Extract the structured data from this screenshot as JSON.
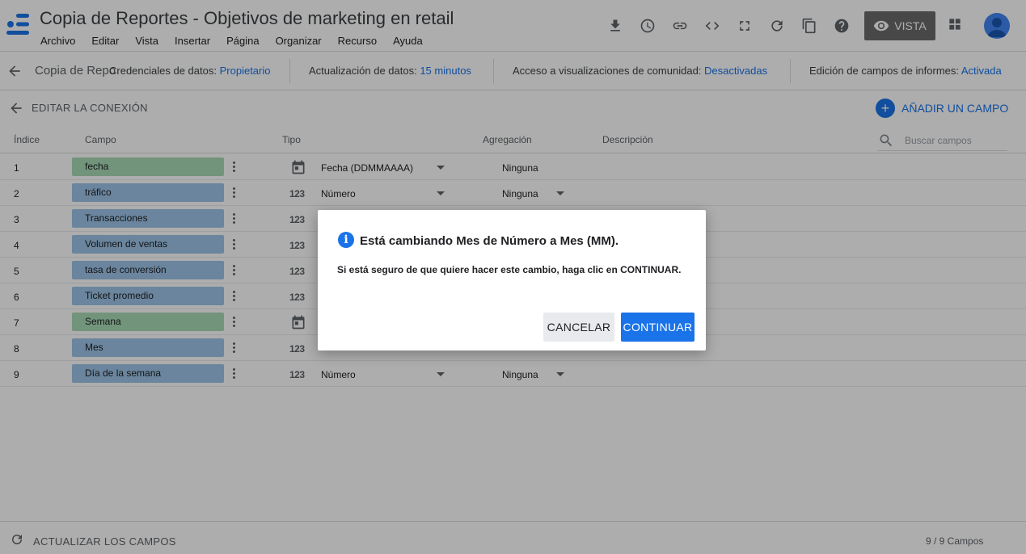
{
  "app": {
    "title": "Copia de Reportes - Objetivos de marketing en retail",
    "menu": [
      "Archivo",
      "Editar",
      "Vista",
      "Insertar",
      "Página",
      "Organizar",
      "Recurso",
      "Ayuda"
    ],
    "view_button": "VISTA"
  },
  "datasource_bar": {
    "name": "Copia de Reportes",
    "credentials_label": "Credenciales de datos:",
    "credentials_value": "Propietario",
    "refresh_label": "Actualización de datos:",
    "refresh_value": "15 minutos",
    "community_label": "Acceso a visualizaciones de comunidad:",
    "community_value": "Desactivadas",
    "editing_label": "Edición de campos de informes:",
    "editing_value": "Activada"
  },
  "editor": {
    "title": "EDITAR LA CONEXIÓN",
    "add_field": "AÑADIR UN CAMPO",
    "search_placeholder": "Buscar campos",
    "columns": {
      "index": "Índice",
      "field": "Campo",
      "type": "Tipo",
      "aggregation": "Agregación",
      "description": "Descripción"
    },
    "rows": [
      {
        "index": "1",
        "field": "fecha",
        "kind": "dimension",
        "type_icon": "calendar-icon",
        "type": "Fecha (DDMMAAAA)",
        "aggregation": "Ninguna"
      },
      {
        "index": "2",
        "field": "tráfico",
        "kind": "metric",
        "type_icon": "number-icon",
        "type": "Número",
        "aggregation": "Ninguna"
      },
      {
        "index": "3",
        "field": "Transacciones",
        "kind": "metric",
        "type_icon": "number-icon",
        "type": "",
        "aggregation": ""
      },
      {
        "index": "4",
        "field": "Volumen de ventas",
        "kind": "metric",
        "type_icon": "number-icon",
        "type": "",
        "aggregation": ""
      },
      {
        "index": "5",
        "field": "tasa de conversión",
        "kind": "metric",
        "type_icon": "number-icon",
        "type": "",
        "aggregation": ""
      },
      {
        "index": "6",
        "field": "Ticket promedio",
        "kind": "metric",
        "type_icon": "number-icon",
        "type": "",
        "aggregation": ""
      },
      {
        "index": "7",
        "field": "Semana",
        "kind": "dimension",
        "type_icon": "calendar-icon",
        "type": "",
        "aggregation": ""
      },
      {
        "index": "8",
        "field": "Mes",
        "kind": "metric",
        "type_icon": "number-icon",
        "type": "",
        "aggregation": ""
      },
      {
        "index": "9",
        "field": "Día de la semana",
        "kind": "metric",
        "type_icon": "number-icon",
        "type": "Número",
        "aggregation": "Ninguna"
      }
    ],
    "number_glyph": "123",
    "refresh_fields": "ACTUALIZAR LOS CAMPOS",
    "field_count": "9 / 9 Campos"
  },
  "dialog": {
    "title": "Está cambiando Mes de Número a Mes (MM).",
    "body": "Si está seguro de que quiere hacer este cambio, haga clic en CONTINUAR.",
    "cancel": "CANCELAR",
    "continue": "CONTINUAR"
  },
  "colors": {
    "accent": "#1a73e8",
    "dimension_chip": "#a8dab5",
    "metric_chip": "#9cc4e8"
  }
}
